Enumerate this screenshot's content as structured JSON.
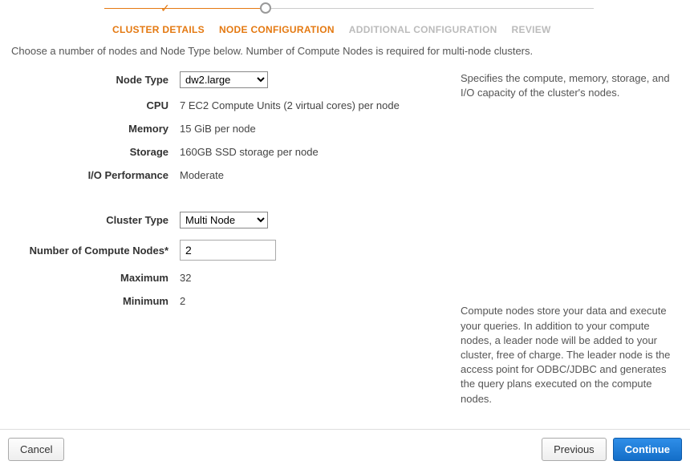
{
  "wizard": {
    "steps": {
      "cluster_details": "CLUSTER DETAILS",
      "node_config": "NODE CONFIGURATION",
      "additional_config": "ADDITIONAL CONFIGURATION",
      "review": "REVIEW"
    }
  },
  "intro_text": "Choose a number of nodes and Node Type below. Number of Compute Nodes is required for multi-node clusters.",
  "form": {
    "node_type": {
      "label": "Node Type",
      "value": "dw2.large"
    },
    "cpu": {
      "label": "CPU",
      "value": "7 EC2 Compute Units (2 virtual cores) per node"
    },
    "memory": {
      "label": "Memory",
      "value": "15 GiB per node"
    },
    "storage": {
      "label": "Storage",
      "value": "160GB SSD storage per node"
    },
    "io_perf": {
      "label": "I/O Performance",
      "value": "Moderate"
    },
    "cluster_type": {
      "label": "Cluster Type",
      "value": "Multi Node"
    },
    "num_nodes": {
      "label": "Number of Compute Nodes*",
      "value": "2"
    },
    "maximum": {
      "label": "Maximum",
      "value": "32"
    },
    "minimum": {
      "label": "Minimum",
      "value": "2"
    }
  },
  "help": {
    "node_type": "Specifies the compute, memory, storage, and I/O capacity of the cluster's nodes.",
    "num_nodes": "Compute nodes store your data and execute your queries. In addition to your compute nodes, a leader node will be added to your cluster, free of charge. The leader node is the access point for ODBC/JDBC and generates the query plans executed on the compute nodes."
  },
  "footer": {
    "cancel": "Cancel",
    "previous": "Previous",
    "continue": "Continue"
  }
}
